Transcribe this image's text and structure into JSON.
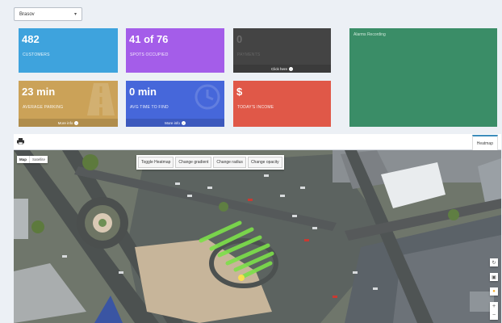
{
  "city_select": {
    "value": "Brasov"
  },
  "tiles": [
    {
      "id": "customers",
      "value": "482",
      "label": "CUSTOMERS"
    },
    {
      "id": "spots",
      "value": "41 of 76",
      "label": "SPOTS OCCUPIED"
    },
    {
      "id": "payments",
      "value": "0",
      "label": "PAYMENTS",
      "footer": "Click here"
    },
    {
      "id": "avg-parking",
      "value": "23 min",
      "label": "AVERAGE PARKING",
      "footer": "More info"
    },
    {
      "id": "avg-find",
      "value": "0 min",
      "label": "AVG TIME TO FIND",
      "footer": "More info"
    },
    {
      "id": "income",
      "value": "$",
      "label": "TODAY'S INCOME"
    }
  ],
  "green_panel": {
    "title": "Alarms Recording"
  },
  "map_header": {
    "tab": "Heatmap"
  },
  "map": {
    "type_buttons": [
      "Map",
      "Satellite"
    ],
    "controls": [
      "Toggle Heatmap",
      "Change gradient",
      "Change radius",
      "Change opacity"
    ]
  },
  "colors": {
    "blue": "#3ea3dd",
    "purple": "#a45de9",
    "dark": "#444444",
    "gold": "#cba258",
    "royal": "#4667da",
    "red": "#e05848",
    "green": "#3a8d67"
  }
}
